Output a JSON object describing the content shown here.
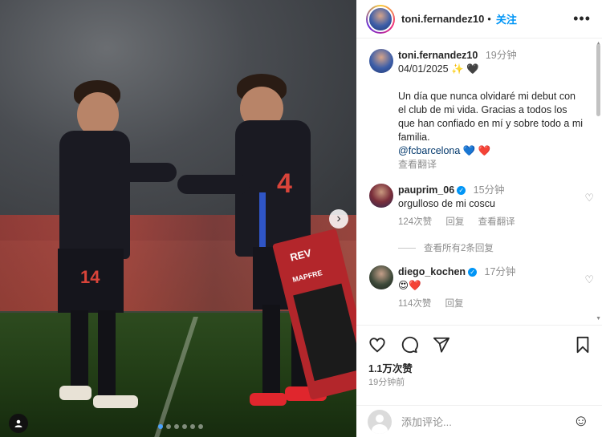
{
  "post": {
    "username": "toni.fernandez10",
    "follow_label": "关注",
    "more_label": "•••",
    "caption": {
      "username": "toni.fernandez10",
      "time": "19分钟",
      "date_line": "04/01/2025",
      "emoji_1": "✨",
      "emoji_2": "🖤",
      "body": "Un día que nunca olvidaré mi debut con el club de mi vida. Gracias a todos los que han confiado en mí y sobre todo a mi familia.",
      "mention": "@fcbarcelona",
      "heart_blue": "💙",
      "heart_red": "❤️",
      "translate_label": "查看翻译"
    },
    "comments": [
      {
        "username": "pauprim_06",
        "time": "15分钟",
        "text": "orgulloso de mi coscu",
        "likes": "124次赞",
        "reply_label": "回复",
        "translate_label": "查看翻译"
      },
      {
        "username": "diego_kochen",
        "time": "17分钟",
        "text": "😍❤️",
        "likes": "114次赞",
        "reply_label": "回复"
      }
    ],
    "view_replies_label": "查看所有2条回复",
    "likes_total": "1.1万次赞",
    "posted_ago": "19分钟前",
    "add_comment_placeholder": "添加评论...",
    "carousel": {
      "total_slides": 6,
      "active_index": 0
    },
    "jersey_numbers": [
      "14",
      "4"
    ],
    "board_text": "REV",
    "board_brand": "MAPFRE"
  },
  "icons": {
    "heart": "heart-icon",
    "comment": "comment-icon",
    "share": "share-icon",
    "save": "bookmark-icon",
    "emoji": "emoji-icon",
    "next": "chevron-right-icon",
    "tag": "user-tag-icon"
  },
  "colors": {
    "accent": "#0095f6",
    "text": "#262626",
    "muted": "#8e8e8e",
    "like_red": "#ed4956"
  }
}
